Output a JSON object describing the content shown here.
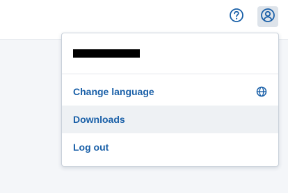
{
  "header": {
    "help_icon": "question-circle-icon",
    "user_icon": "user-circle-icon",
    "accent_color": "#1a60a8"
  },
  "dropdown": {
    "account_name": "",
    "items": [
      {
        "label": "Change language",
        "icon": "globe-icon"
      },
      {
        "label": "Downloads",
        "state": "hovered"
      },
      {
        "label": "Log out"
      }
    ]
  }
}
